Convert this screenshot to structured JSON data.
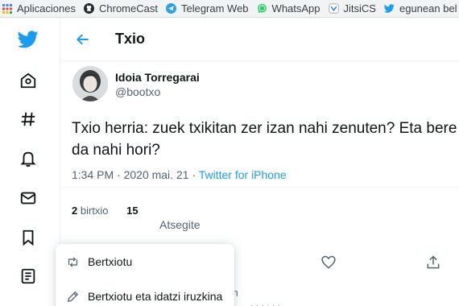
{
  "bookmarks": [
    {
      "label": "Aplicaciones",
      "icon": "apps-grid-icon"
    },
    {
      "label": "ChromeCast",
      "icon": "github-icon"
    },
    {
      "label": "Telegram Web",
      "icon": "telegram-icon"
    },
    {
      "label": "WhatsApp",
      "icon": "whatsapp-icon"
    },
    {
      "label": "JitsiCS",
      "icon": "jitsi-icon"
    },
    {
      "label": "egunean bel",
      "icon": "twitter-bird-icon"
    }
  ],
  "nav": {
    "icons": [
      "twitter-logo-icon",
      "home-icon",
      "hashtag-icon",
      "bell-icon",
      "mail-icon",
      "bookmark-icon",
      "list-icon"
    ]
  },
  "header": {
    "title": "Txio"
  },
  "tweet": {
    "author": "Idoia Torregarai",
    "handle": "@bootxo",
    "text": "Txio herria: zuek txikitan zer izan nahi zenuten? Eta bere da nahi hori?",
    "time": "1:34 PM · 2020 mai. 21 · ",
    "source": "Twitter for iPhone"
  },
  "stats": {
    "retweets_count": "2",
    "retweets_label": "birtxio",
    "likes_count": "15",
    "likes_label": "Atsegite"
  },
  "menu": {
    "items": [
      {
        "label": "Bertxiotu",
        "icon": "retweet-icon"
      },
      {
        "label": "Bertxiotu eta idatzi iruzkina",
        "icon": "pencil-icon"
      }
    ]
  },
  "below": {
    "time": "l h"
  },
  "colors": {
    "accent": "#1d9bf0",
    "text": "#0f1419",
    "muted": "#536471"
  }
}
